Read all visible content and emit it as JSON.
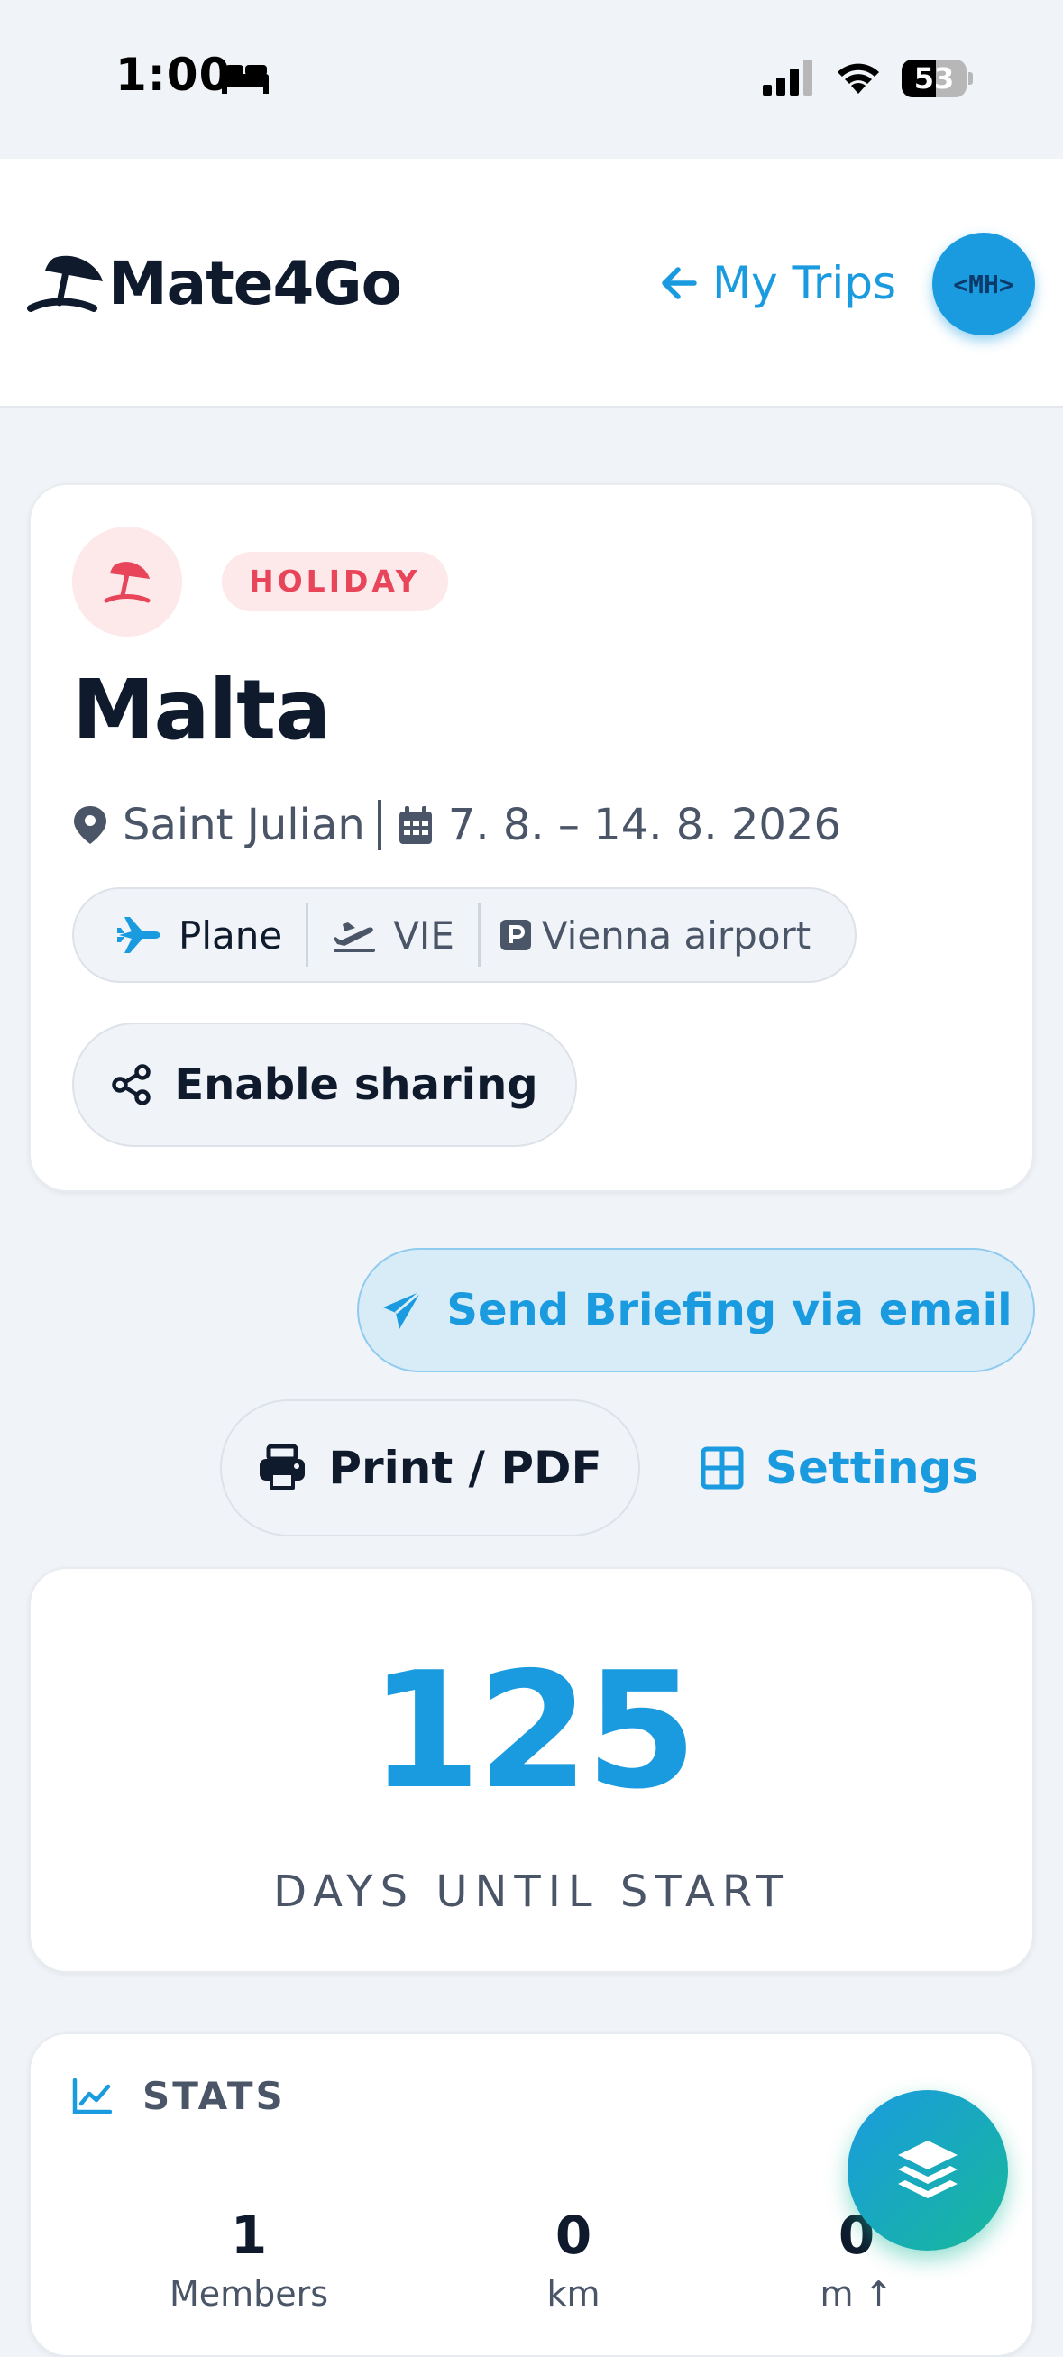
{
  "status_bar": {
    "time": "1:00",
    "battery_level": "53",
    "battery_fraction": 0.53
  },
  "header": {
    "app_name": "Mate4Go",
    "back_link_label": "My Trips",
    "avatar_initials": "<MH>"
  },
  "trip": {
    "type_badge": "HOLIDAY",
    "title": "Malta",
    "location": "Saint Julian",
    "dates": "7. 8. – 14. 8. 2026",
    "transport": {
      "mode": "Plane",
      "departure_code": "VIE",
      "parking": "Vienna airport"
    },
    "share_label": "Enable sharing"
  },
  "actions": {
    "briefing_label": "Send Briefing via email",
    "print_label": "Print / PDF",
    "settings_label": "Settings"
  },
  "countdown": {
    "value": "125",
    "label": "DAYS UNTIL START"
  },
  "stats": {
    "heading": "STATS",
    "items": [
      {
        "value": "1",
        "label": "Members"
      },
      {
        "value": "0",
        "label": "km"
      },
      {
        "value": "0",
        "label": "m ↑"
      }
    ]
  },
  "colors": {
    "accent": "#1a9be0",
    "holiday": "#e8445a",
    "text": "#0f1b2d",
    "muted": "#4a5568",
    "background": "#f0f3f7"
  },
  "icons": {
    "status": [
      "bed-icon",
      "cellular-signal-icon",
      "wifi-icon",
      "battery-icon"
    ],
    "header": [
      "beach-umbrella-logo-icon",
      "arrow-left-icon"
    ],
    "trip": [
      "beach-umbrella-icon",
      "map-pin-icon",
      "calendar-icon",
      "plane-icon",
      "plane-departure-icon",
      "parking-icon",
      "share-icon"
    ],
    "actions": [
      "paper-plane-icon",
      "printer-icon",
      "grid-icon"
    ],
    "stats": [
      "chart-line-icon"
    ],
    "fab": "layers-icon"
  }
}
